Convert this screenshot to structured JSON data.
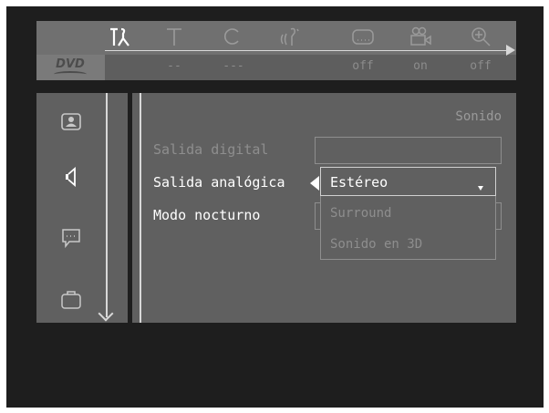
{
  "logo": "DVD",
  "tabs": [
    {
      "icon": "tools-icon",
      "value": ""
    },
    {
      "icon": "title-icon",
      "value": "--"
    },
    {
      "icon": "chapter-icon",
      "value": "---"
    },
    {
      "icon": "audio-language-icon",
      "value": ""
    },
    {
      "icon": "subtitle-icon",
      "value": "off"
    },
    {
      "icon": "camera-angle-icon",
      "value": "on"
    },
    {
      "icon": "zoom-icon",
      "value": "off"
    }
  ],
  "sidebar": {
    "items": [
      {
        "icon": "picture-icon"
      },
      {
        "icon": "speaker-icon"
      },
      {
        "icon": "language-speech-icon"
      },
      {
        "icon": "features-briefcase-icon"
      }
    ]
  },
  "section_title": "Sonido",
  "rows": [
    {
      "label": "Salida digital"
    },
    {
      "label": "Salida analógica"
    },
    {
      "label": "Modo nocturno"
    }
  ],
  "dropdown": {
    "selected": "Estéreo",
    "options": [
      "Surround",
      "Sonido en 3D"
    ]
  },
  "colors": {
    "screen_bg": "#1e1e1e",
    "panel_bg": "#606060",
    "active_text": "#ffffff",
    "inactive_text": "#8e8e8e"
  }
}
